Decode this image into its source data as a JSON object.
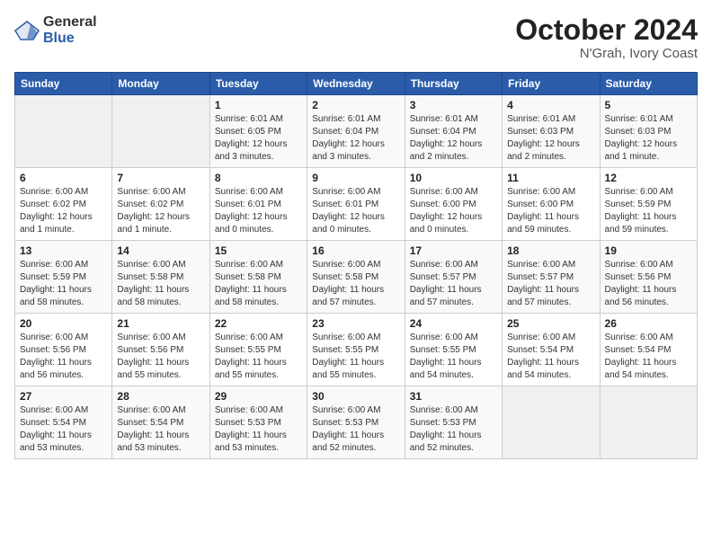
{
  "header": {
    "logo_general": "General",
    "logo_blue": "Blue",
    "title": "October 2024",
    "subtitle": "N'Grah, Ivory Coast"
  },
  "weekdays": [
    "Sunday",
    "Monday",
    "Tuesday",
    "Wednesday",
    "Thursday",
    "Friday",
    "Saturday"
  ],
  "weeks": [
    [
      {
        "day": "",
        "info": ""
      },
      {
        "day": "",
        "info": ""
      },
      {
        "day": "1",
        "info": "Sunrise: 6:01 AM\nSunset: 6:05 PM\nDaylight: 12 hours and 3 minutes."
      },
      {
        "day": "2",
        "info": "Sunrise: 6:01 AM\nSunset: 6:04 PM\nDaylight: 12 hours and 3 minutes."
      },
      {
        "day": "3",
        "info": "Sunrise: 6:01 AM\nSunset: 6:04 PM\nDaylight: 12 hours and 2 minutes."
      },
      {
        "day": "4",
        "info": "Sunrise: 6:01 AM\nSunset: 6:03 PM\nDaylight: 12 hours and 2 minutes."
      },
      {
        "day": "5",
        "info": "Sunrise: 6:01 AM\nSunset: 6:03 PM\nDaylight: 12 hours and 1 minute."
      }
    ],
    [
      {
        "day": "6",
        "info": "Sunrise: 6:00 AM\nSunset: 6:02 PM\nDaylight: 12 hours and 1 minute."
      },
      {
        "day": "7",
        "info": "Sunrise: 6:00 AM\nSunset: 6:02 PM\nDaylight: 12 hours and 1 minute."
      },
      {
        "day": "8",
        "info": "Sunrise: 6:00 AM\nSunset: 6:01 PM\nDaylight: 12 hours and 0 minutes."
      },
      {
        "day": "9",
        "info": "Sunrise: 6:00 AM\nSunset: 6:01 PM\nDaylight: 12 hours and 0 minutes."
      },
      {
        "day": "10",
        "info": "Sunrise: 6:00 AM\nSunset: 6:00 PM\nDaylight: 12 hours and 0 minutes."
      },
      {
        "day": "11",
        "info": "Sunrise: 6:00 AM\nSunset: 6:00 PM\nDaylight: 11 hours and 59 minutes."
      },
      {
        "day": "12",
        "info": "Sunrise: 6:00 AM\nSunset: 5:59 PM\nDaylight: 11 hours and 59 minutes."
      }
    ],
    [
      {
        "day": "13",
        "info": "Sunrise: 6:00 AM\nSunset: 5:59 PM\nDaylight: 11 hours and 58 minutes."
      },
      {
        "day": "14",
        "info": "Sunrise: 6:00 AM\nSunset: 5:58 PM\nDaylight: 11 hours and 58 minutes."
      },
      {
        "day": "15",
        "info": "Sunrise: 6:00 AM\nSunset: 5:58 PM\nDaylight: 11 hours and 58 minutes."
      },
      {
        "day": "16",
        "info": "Sunrise: 6:00 AM\nSunset: 5:58 PM\nDaylight: 11 hours and 57 minutes."
      },
      {
        "day": "17",
        "info": "Sunrise: 6:00 AM\nSunset: 5:57 PM\nDaylight: 11 hours and 57 minutes."
      },
      {
        "day": "18",
        "info": "Sunrise: 6:00 AM\nSunset: 5:57 PM\nDaylight: 11 hours and 57 minutes."
      },
      {
        "day": "19",
        "info": "Sunrise: 6:00 AM\nSunset: 5:56 PM\nDaylight: 11 hours and 56 minutes."
      }
    ],
    [
      {
        "day": "20",
        "info": "Sunrise: 6:00 AM\nSunset: 5:56 PM\nDaylight: 11 hours and 56 minutes."
      },
      {
        "day": "21",
        "info": "Sunrise: 6:00 AM\nSunset: 5:56 PM\nDaylight: 11 hours and 55 minutes."
      },
      {
        "day": "22",
        "info": "Sunrise: 6:00 AM\nSunset: 5:55 PM\nDaylight: 11 hours and 55 minutes."
      },
      {
        "day": "23",
        "info": "Sunrise: 6:00 AM\nSunset: 5:55 PM\nDaylight: 11 hours and 55 minutes."
      },
      {
        "day": "24",
        "info": "Sunrise: 6:00 AM\nSunset: 5:55 PM\nDaylight: 11 hours and 54 minutes."
      },
      {
        "day": "25",
        "info": "Sunrise: 6:00 AM\nSunset: 5:54 PM\nDaylight: 11 hours and 54 minutes."
      },
      {
        "day": "26",
        "info": "Sunrise: 6:00 AM\nSunset: 5:54 PM\nDaylight: 11 hours and 54 minutes."
      }
    ],
    [
      {
        "day": "27",
        "info": "Sunrise: 6:00 AM\nSunset: 5:54 PM\nDaylight: 11 hours and 53 minutes."
      },
      {
        "day": "28",
        "info": "Sunrise: 6:00 AM\nSunset: 5:54 PM\nDaylight: 11 hours and 53 minutes."
      },
      {
        "day": "29",
        "info": "Sunrise: 6:00 AM\nSunset: 5:53 PM\nDaylight: 11 hours and 53 minutes."
      },
      {
        "day": "30",
        "info": "Sunrise: 6:00 AM\nSunset: 5:53 PM\nDaylight: 11 hours and 52 minutes."
      },
      {
        "day": "31",
        "info": "Sunrise: 6:00 AM\nSunset: 5:53 PM\nDaylight: 11 hours and 52 minutes."
      },
      {
        "day": "",
        "info": ""
      },
      {
        "day": "",
        "info": ""
      }
    ]
  ]
}
